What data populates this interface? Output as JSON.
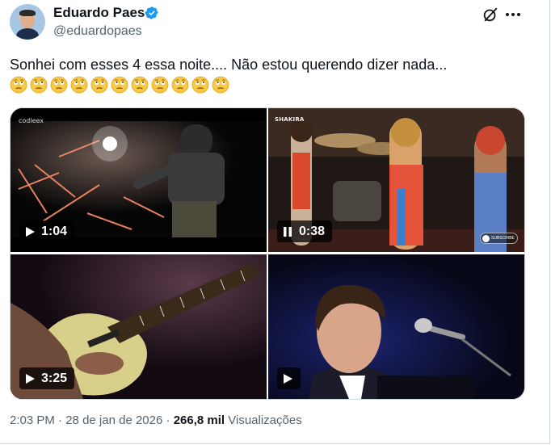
{
  "author": {
    "name": "Eduardo Paes",
    "handle": "@eduardopaes",
    "verified": true
  },
  "post": {
    "text": "Sonhei com esses 4 essa noite.... Não estou querendo dizer nada...",
    "emoji_name": "face-with-rolling-eyes",
    "emoji_count": 11
  },
  "media": [
    {
      "duration": "1:04",
      "state": "play",
      "watermark": "codleex"
    },
    {
      "duration": "0:38",
      "state": "pause",
      "logo": "SHAKIRA",
      "subscribe": "SUBSCRIBE"
    },
    {
      "duration": "3:25",
      "state": "play"
    },
    {
      "duration": "",
      "state": "play"
    }
  ],
  "meta": {
    "time": "2:03 PM",
    "separator": "·",
    "date": "28 de jan de 2026",
    "views_count": "266,8 mil",
    "views_label": "Visualizações"
  },
  "colors": {
    "verified": "#1d9bf0",
    "secondary_text": "#536471",
    "primary_text": "#0f1419",
    "border": "#cfd9de"
  },
  "icons": [
    "verified-badge-icon",
    "grok-icon",
    "more-icon",
    "play-icon",
    "pause-icon",
    "face-with-rolling-eyes-icon"
  ]
}
